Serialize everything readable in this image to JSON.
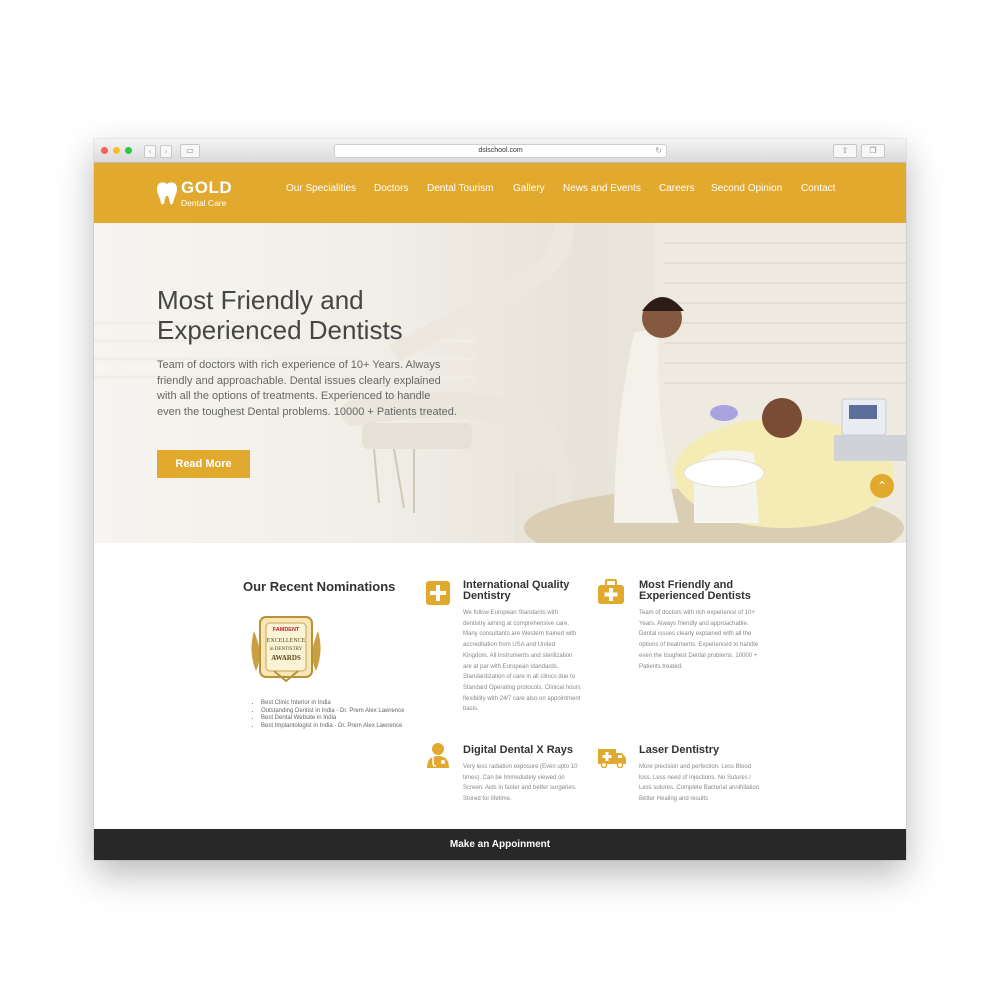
{
  "browser": {
    "url": "dslschool.com"
  },
  "brand": {
    "name": "GOLD",
    "tagline": "Dental Care",
    "accent": "#e2a92f"
  },
  "nav": {
    "items": [
      "Our Specialities",
      "Doctors",
      "Dental Tourism",
      "Gallery",
      "News and Events",
      "Careers",
      "Second Opinion",
      "Contact"
    ]
  },
  "hero": {
    "title_line1": "Most Friendly and",
    "title_line2": "Experienced Dentists",
    "text": "Team of doctors with rich experience of 10+ Years. Always friendly and approachable. Dental issues clearly explained with all the options of treatments. Experienced to handle even the toughest Dental problems. 10000 + Patients treated.",
    "button": "Read More"
  },
  "nominations": {
    "title": "Our Recent Nominations",
    "badge_brand": "FAMDENT",
    "badge_line1": "EXCELLENCE",
    "badge_line2": "in DENTISTRY",
    "badge_line3": "AWARDS",
    "items": [
      "Best Clinic Interior in India",
      "Outstanding Dentist in India - Dr. Prem Alex Lawrence",
      "Best Dental Website in India",
      "Best Implantologist in India - Dr. Prem Alex Lawrence"
    ]
  },
  "features": [
    {
      "icon": "plus-box-icon",
      "title_line1": "International Quality",
      "title_line2": "Dentistry",
      "text": "We follow European Standards with dentistry aiming at comprehensive care. Many consultants are Western trained with accreditation from USA and United Kingdom. All instruments and sterilization are at par with European standards. Standardization of care in all clinics due to Standard Operating protocols. Clinical hours flexibility with 24/7 care also on appointment basis."
    },
    {
      "icon": "first-aid-kit-icon",
      "title_line1": "Most Friendly and",
      "title_line2": "Experienced Dentists",
      "text": "Team of doctors with rich experience of 10+ Years. Always friendly and approachable. Dental issues clearly explained with all the options of treatments. Experienced to handle even the toughest Dental problems. 10000 + Patients treated."
    },
    {
      "icon": "doctor-icon",
      "title_line1": "Digital Dental X Rays",
      "title_line2": "",
      "text": "Very less radiation exposure (Even upto 10 times). Can be Immediately viewed on Screen. Aids in faster and better surgeries. Stored for lifetime."
    },
    {
      "icon": "ambulance-icon",
      "title_line1": "Laser Dentistry",
      "title_line2": "",
      "text": "More precision and perfection. Less Blood loss. Less need of Injections. No Sutures / Less sutures. Complete Bacterial annihilation. Better Healing and results"
    }
  ],
  "footer": {
    "cta": "Make an Appoinment"
  }
}
